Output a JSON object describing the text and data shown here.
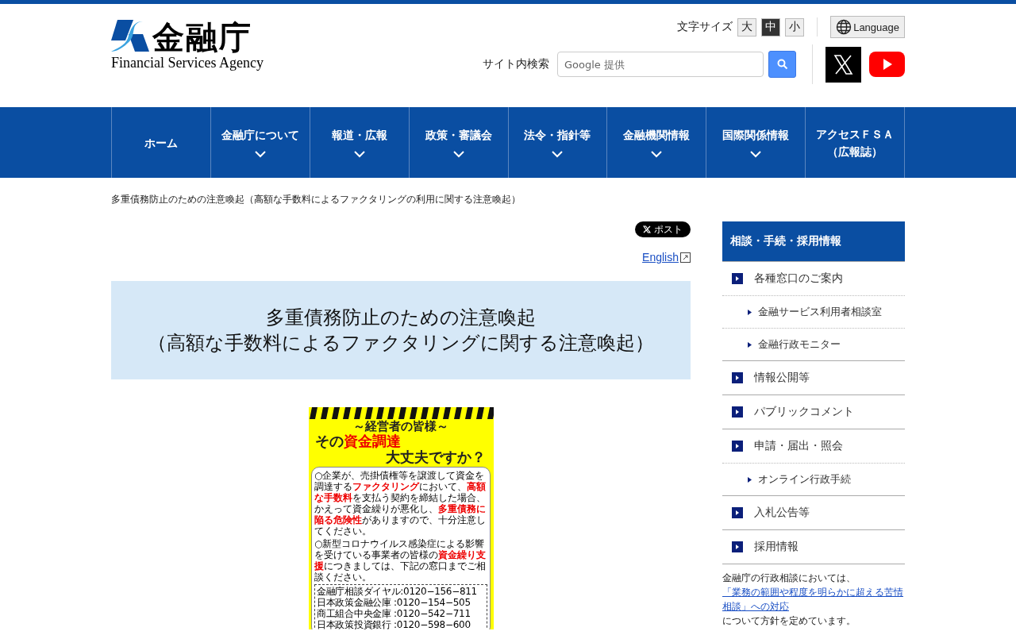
{
  "header": {
    "logo_title": "金融庁",
    "logo_subtitle": "Financial Services Agency",
    "font_size_label": "文字サイズ",
    "font_sizes": [
      {
        "label": "大",
        "selected": false
      },
      {
        "label": "中",
        "selected": true
      },
      {
        "label": "小",
        "selected": false
      }
    ],
    "language": "Language",
    "search_label": "サイト内検索",
    "search_placeholder": "Google 提供"
  },
  "nav": [
    {
      "lines": [
        "ホーム"
      ],
      "dropdown": false
    },
    {
      "lines": [
        "金融庁について"
      ],
      "dropdown": true
    },
    {
      "lines": [
        "報道・広報"
      ],
      "dropdown": true
    },
    {
      "lines": [
        "政策・審議会"
      ],
      "dropdown": true
    },
    {
      "lines": [
        "法令・指針等"
      ],
      "dropdown": true
    },
    {
      "lines": [
        "金融機関情報"
      ],
      "dropdown": true
    },
    {
      "lines": [
        "国際関係情報"
      ],
      "dropdown": true
    },
    {
      "lines": [
        "アクセスＦＳＡ",
        "（広報誌）"
      ],
      "dropdown": false
    }
  ],
  "breadcrumb": "多重債務防止のための注意喚起（高額な手数料によるファクタリングの利用に関する注意喚起）",
  "post_button": "ポスト",
  "english_link": "English",
  "page_title": [
    "多重債務防止のための注意喚起",
    "（高額な手数料によるファクタリングに関する注意喚起）"
  ],
  "poster": {
    "greeting": "～経営者の皆様～",
    "headline": "その**資金調達**",
    "headline_2": "大丈夫ですか？",
    "paragraphs": [
      "○企業が、売掛債権等を譲渡して資金を調達する**ファクタリング**において、**高額な手数料**を支払う契約を締結した場合、かえって資金繰りが悪化し、**多重債務に陥る危険性**がありますので、十分注意してください。",
      "○新型コロナウイルス感染症による影響を受けている事業者の皆様の**資金繰り支援**につきましては、下記の窓口までご相談ください。"
    ],
    "contacts": [
      "金融庁相談ダイヤル:0120−156−811",
      "日本政策金融公庫 :0120−154−505",
      "商工組合中央金庫 :0120−542−711",
      "日本政策投資銀行 :0120−598−600"
    ]
  },
  "sidebar": {
    "heading": "相談・手続・採用情報",
    "items": [
      {
        "kind": "main",
        "label": "各種窓口のご案内"
      },
      {
        "kind": "sub",
        "label": "金融サービス利用者相談室"
      },
      {
        "kind": "sub",
        "label": "金融行政モニター"
      },
      {
        "kind": "main",
        "label": "情報公開等"
      },
      {
        "kind": "main",
        "label": "パブリックコメント"
      },
      {
        "kind": "main",
        "label": "申請・届出・照会"
      },
      {
        "kind": "sub",
        "label": "オンライン行政手続"
      },
      {
        "kind": "main",
        "label": "入札公告等"
      },
      {
        "kind": "main",
        "label": "採用情報"
      }
    ],
    "note_before": "金融庁の行政相談においては、",
    "note_link": "「業務の範囲や程度を明らかに超える苦情相談」への対応",
    "note_after": "について方針を定めています。"
  }
}
